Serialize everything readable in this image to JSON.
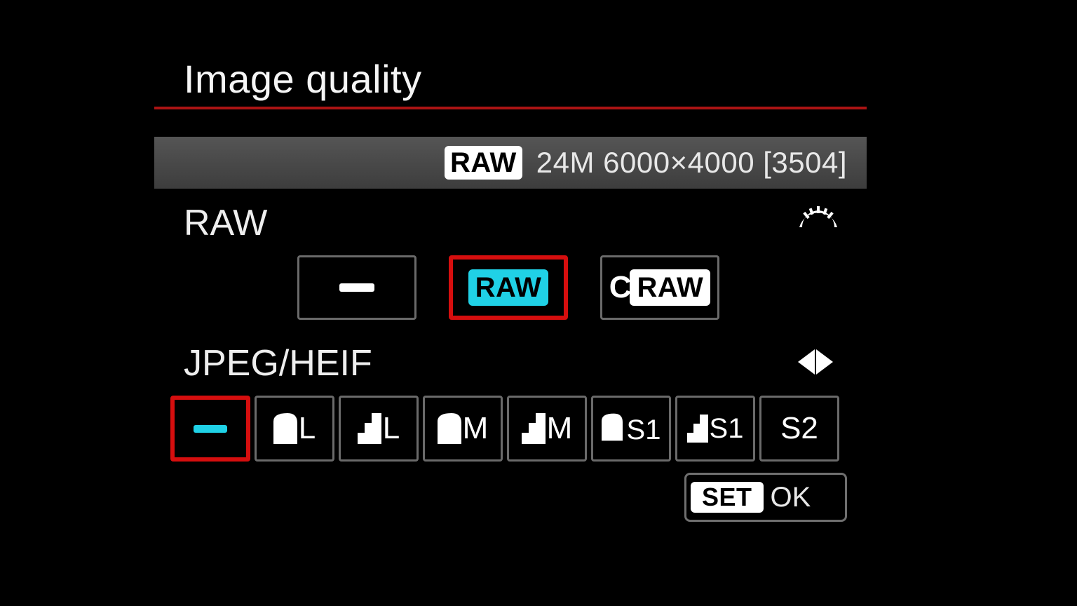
{
  "title": "Image quality",
  "info": {
    "raw_badge": "RAW",
    "summary": "24M 6000×4000 [3504]"
  },
  "raw_section": {
    "label": "RAW",
    "options": [
      {
        "id": "raw-none",
        "selected": false,
        "kind": "dash"
      },
      {
        "id": "raw-raw",
        "selected": true,
        "kind": "raw",
        "label": "RAW"
      },
      {
        "id": "raw-craw",
        "selected": false,
        "kind": "craw",
        "c": "C",
        "label": "RAW"
      }
    ]
  },
  "jpeg_section": {
    "label": "JPEG/HEIF",
    "options": [
      {
        "id": "jpeg-none",
        "selected": true,
        "kind": "dash"
      },
      {
        "id": "jpeg-l-fine",
        "selected": false,
        "kind": "q",
        "q": "fine",
        "label": "L"
      },
      {
        "id": "jpeg-l-normal",
        "selected": false,
        "kind": "q",
        "q": "normal",
        "label": "L"
      },
      {
        "id": "jpeg-m-fine",
        "selected": false,
        "kind": "q",
        "q": "fine",
        "label": "M"
      },
      {
        "id": "jpeg-m-normal",
        "selected": false,
        "kind": "q",
        "q": "normal",
        "label": "M"
      },
      {
        "id": "jpeg-s1-fine",
        "selected": false,
        "kind": "q",
        "q": "fine",
        "label": "S1"
      },
      {
        "id": "jpeg-s1-normal",
        "selected": false,
        "kind": "q",
        "q": "normal",
        "label": "S1"
      },
      {
        "id": "jpeg-s2",
        "selected": false,
        "kind": "text",
        "label": "S2"
      }
    ]
  },
  "footer": {
    "set": "SET",
    "ok": "OK"
  }
}
